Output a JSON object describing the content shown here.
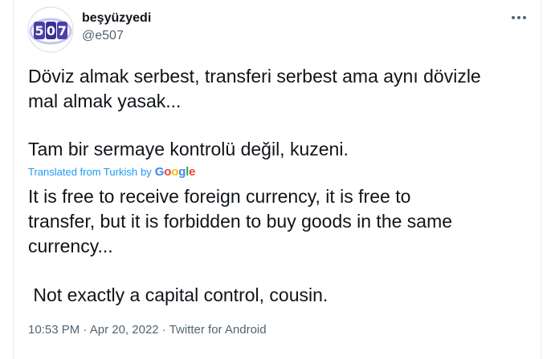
{
  "author": {
    "display_name": "beşyüzyedi",
    "handle": "@e507",
    "avatar_text": "507",
    "avatar_icon": "profile-avatar"
  },
  "menu_icon": "more-options-icon",
  "tweet": {
    "original_line1": "Döviz almak serbest, transferi serbest ama aynı dövizle",
    "original_line2": "mal almak yasak...",
    "original_line3": "Tam bir sermaye kontrolü değil, kuzeni.",
    "translation_label": "Translated from Turkish",
    "translation_by": "by",
    "translation_provider": "Google",
    "translated_line1": "It is free to receive foreign currency, it is free to",
    "translated_line2": "transfer, but it is forbidden to buy goods in the same",
    "translated_line3": "currency...",
    "translated_line4": " Not exactly a capital control, cousin."
  },
  "meta": {
    "time": "10:53 PM",
    "separator": " · ",
    "date": "Apr 20, 2022",
    "source": "Twitter for Android"
  },
  "colors": {
    "text": "#0f1419",
    "secondary": "#536471",
    "link": "#1d9bf0",
    "avatar_purple": "#3b2f93"
  }
}
